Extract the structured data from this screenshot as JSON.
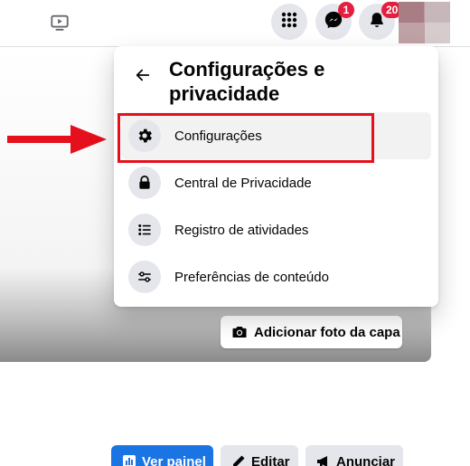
{
  "topbar": {
    "messenger_badge": "1",
    "notifications_badge": "20",
    "icons": [
      "watch-icon",
      "grid-menu-icon",
      "messenger-icon",
      "bell-icon"
    ]
  },
  "settings_panel": {
    "title": "Configurações e privacidade",
    "items": [
      {
        "label": "Configurações",
        "icon": "gear-icon"
      },
      {
        "label": "Central de Privacidade",
        "icon": "lock-icon"
      },
      {
        "label": "Registro de atividades",
        "icon": "list-icon"
      },
      {
        "label": "Preferências de conteúdo",
        "icon": "sliders-icon"
      }
    ]
  },
  "cover": {
    "add_cover_label": "Adicionar foto da capa"
  },
  "actions": {
    "dashboard_label": "Ver painel",
    "edit_label": "Editar",
    "ads_label": "Anunciar"
  },
  "colors": {
    "accent": "#1b74e4",
    "annotation_red": "#e5101b",
    "badge_red": "#e41e3f"
  }
}
